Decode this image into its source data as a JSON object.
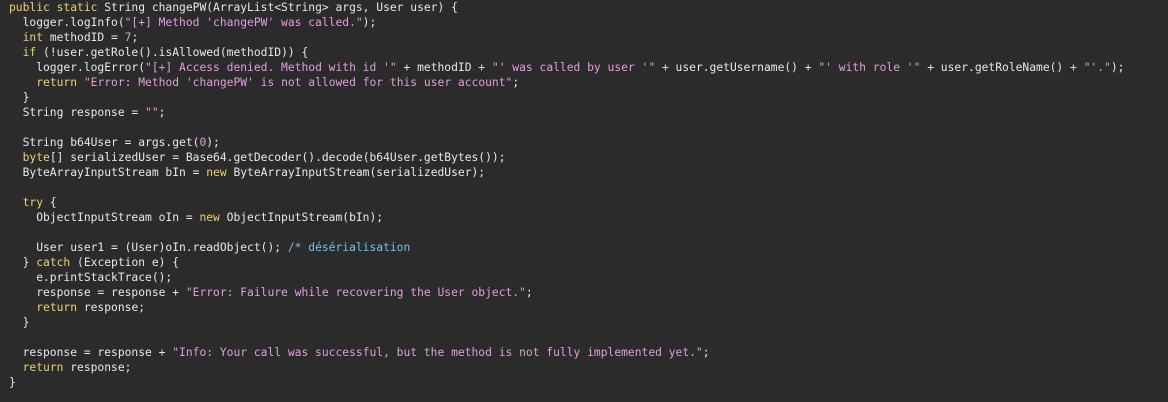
{
  "colors": {
    "background": "#2b2b2b",
    "plain": "#e8e8e8",
    "keyword": "#f0d070",
    "string": "#e59be3",
    "number": "#e59be3",
    "comment": "#6ec8e0"
  },
  "code_lines": [
    [
      {
        "t": "kw",
        "v": "public static"
      },
      {
        "t": "pl",
        "v": " String changePW(ArrayList<String> args, User user) {"
      }
    ],
    [
      {
        "t": "pl",
        "v": "  logger.logInfo("
      },
      {
        "t": "str",
        "v": "\"[+] Method 'changePW' was called.\""
      },
      {
        "t": "pl",
        "v": ");"
      }
    ],
    [
      {
        "t": "pl",
        "v": "  "
      },
      {
        "t": "kw",
        "v": "int"
      },
      {
        "t": "pl",
        "v": " methodID = "
      },
      {
        "t": "num",
        "v": "7"
      },
      {
        "t": "pl",
        "v": ";"
      }
    ],
    [
      {
        "t": "pl",
        "v": "  "
      },
      {
        "t": "kw",
        "v": "if"
      },
      {
        "t": "pl",
        "v": " (!user.getRole().isAllowed(methodID)) {"
      }
    ],
    [
      {
        "t": "pl",
        "v": "    logger.logError("
      },
      {
        "t": "str",
        "v": "\"[+] Access denied. Method with id '\""
      },
      {
        "t": "pl",
        "v": " + methodID + "
      },
      {
        "t": "str",
        "v": "\"' was called by user '\""
      },
      {
        "t": "pl",
        "v": " + user.getUsername() + "
      },
      {
        "t": "str",
        "v": "\"' with role '\""
      },
      {
        "t": "pl",
        "v": " + user.getRoleName() + "
      },
      {
        "t": "str",
        "v": "\"'.\""
      },
      {
        "t": "pl",
        "v": ");"
      }
    ],
    [
      {
        "t": "pl",
        "v": "    "
      },
      {
        "t": "kw",
        "v": "return"
      },
      {
        "t": "pl",
        "v": " "
      },
      {
        "t": "str",
        "v": "\"Error: Method 'changePW' is not allowed for this user account\""
      },
      {
        "t": "pl",
        "v": ";"
      }
    ],
    [
      {
        "t": "pl",
        "v": "  }"
      }
    ],
    [
      {
        "t": "pl",
        "v": "  String response = "
      },
      {
        "t": "str",
        "v": "\"\""
      },
      {
        "t": "pl",
        "v": ";"
      }
    ],
    [],
    [
      {
        "t": "pl",
        "v": "  String b64User = args.get("
      },
      {
        "t": "num",
        "v": "0"
      },
      {
        "t": "pl",
        "v": ");"
      }
    ],
    [
      {
        "t": "pl",
        "v": "  "
      },
      {
        "t": "kw",
        "v": "byte"
      },
      {
        "t": "pl",
        "v": "[] serializedUser = Base64.getDecoder().decode(b64User.getBytes());"
      }
    ],
    [
      {
        "t": "pl",
        "v": "  ByteArrayInputStream bIn = "
      },
      {
        "t": "kw",
        "v": "new"
      },
      {
        "t": "pl",
        "v": " ByteArrayInputStream(serializedUser);"
      }
    ],
    [],
    [
      {
        "t": "pl",
        "v": "  "
      },
      {
        "t": "kw",
        "v": "try"
      },
      {
        "t": "pl",
        "v": " {"
      }
    ],
    [
      {
        "t": "pl",
        "v": "    ObjectInputStream oIn = "
      },
      {
        "t": "kw",
        "v": "new"
      },
      {
        "t": "pl",
        "v": " ObjectInputStream(bIn);"
      }
    ],
    [],
    [
      {
        "t": "pl",
        "v": "    User user1 = (User)oIn.readObject(); "
      },
      {
        "t": "cm",
        "v": "/* désérialisation"
      }
    ],
    [
      {
        "t": "pl",
        "v": "  } "
      },
      {
        "t": "kw",
        "v": "catch"
      },
      {
        "t": "pl",
        "v": " (Exception e) {"
      }
    ],
    [
      {
        "t": "pl",
        "v": "    e.printStackTrace();"
      }
    ],
    [
      {
        "t": "pl",
        "v": "    response = response + "
      },
      {
        "t": "str",
        "v": "\"Error: Failure while recovering the User object.\""
      },
      {
        "t": "pl",
        "v": ";"
      }
    ],
    [
      {
        "t": "pl",
        "v": "    "
      },
      {
        "t": "kw",
        "v": "return"
      },
      {
        "t": "pl",
        "v": " response;"
      }
    ],
    [
      {
        "t": "pl",
        "v": "  }"
      }
    ],
    [],
    [
      {
        "t": "pl",
        "v": "  response = response + "
      },
      {
        "t": "str",
        "v": "\"Info: Your call was successful, but the method is not fully implemented yet.\""
      },
      {
        "t": "pl",
        "v": ";"
      }
    ],
    [
      {
        "t": "pl",
        "v": "  "
      },
      {
        "t": "kw",
        "v": "return"
      },
      {
        "t": "pl",
        "v": " response;"
      }
    ],
    [
      {
        "t": "pl",
        "v": "}"
      }
    ]
  ]
}
